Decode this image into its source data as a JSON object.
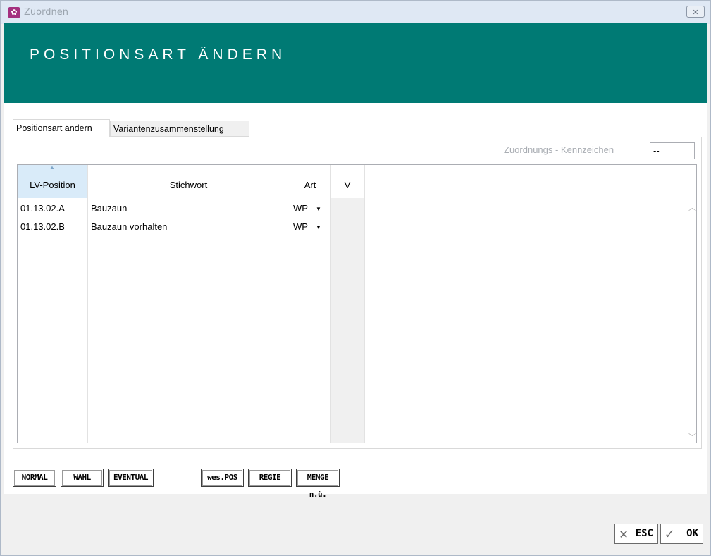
{
  "window": {
    "title": "Zuordnen",
    "close_label": "☒"
  },
  "banner": {
    "title": "POSITIONSART ÄNDERN"
  },
  "tabs": [
    {
      "label": "Positionsart ändern",
      "active": true
    },
    {
      "label": "Variantenzusammenstellung",
      "active": false
    }
  ],
  "kennzeichen": {
    "label": "Zuordnungs - Kennzeichen",
    "value": "--"
  },
  "grid": {
    "columns": [
      "LV-Position",
      "Stichwort",
      "Art",
      "V"
    ],
    "rows": [
      {
        "position": "01.13.02.A",
        "stichwort": "Bauzaun",
        "art": "WP"
      },
      {
        "position": "01.13.02.B",
        "stichwort": "Bauzaun vorhalten",
        "art": "WP"
      }
    ]
  },
  "buttons": {
    "normal": "NORMAL",
    "wahl": "WAHL",
    "eventual": "EVENTUAL",
    "wes_pos": "wes.POS",
    "regie": "REGIE",
    "menge": "MENGE n.ü."
  },
  "footer": {
    "esc": "ESC",
    "ok": "OK"
  },
  "colors": {
    "banner": "#007a74",
    "sorted_header": "#d9ebf9"
  }
}
